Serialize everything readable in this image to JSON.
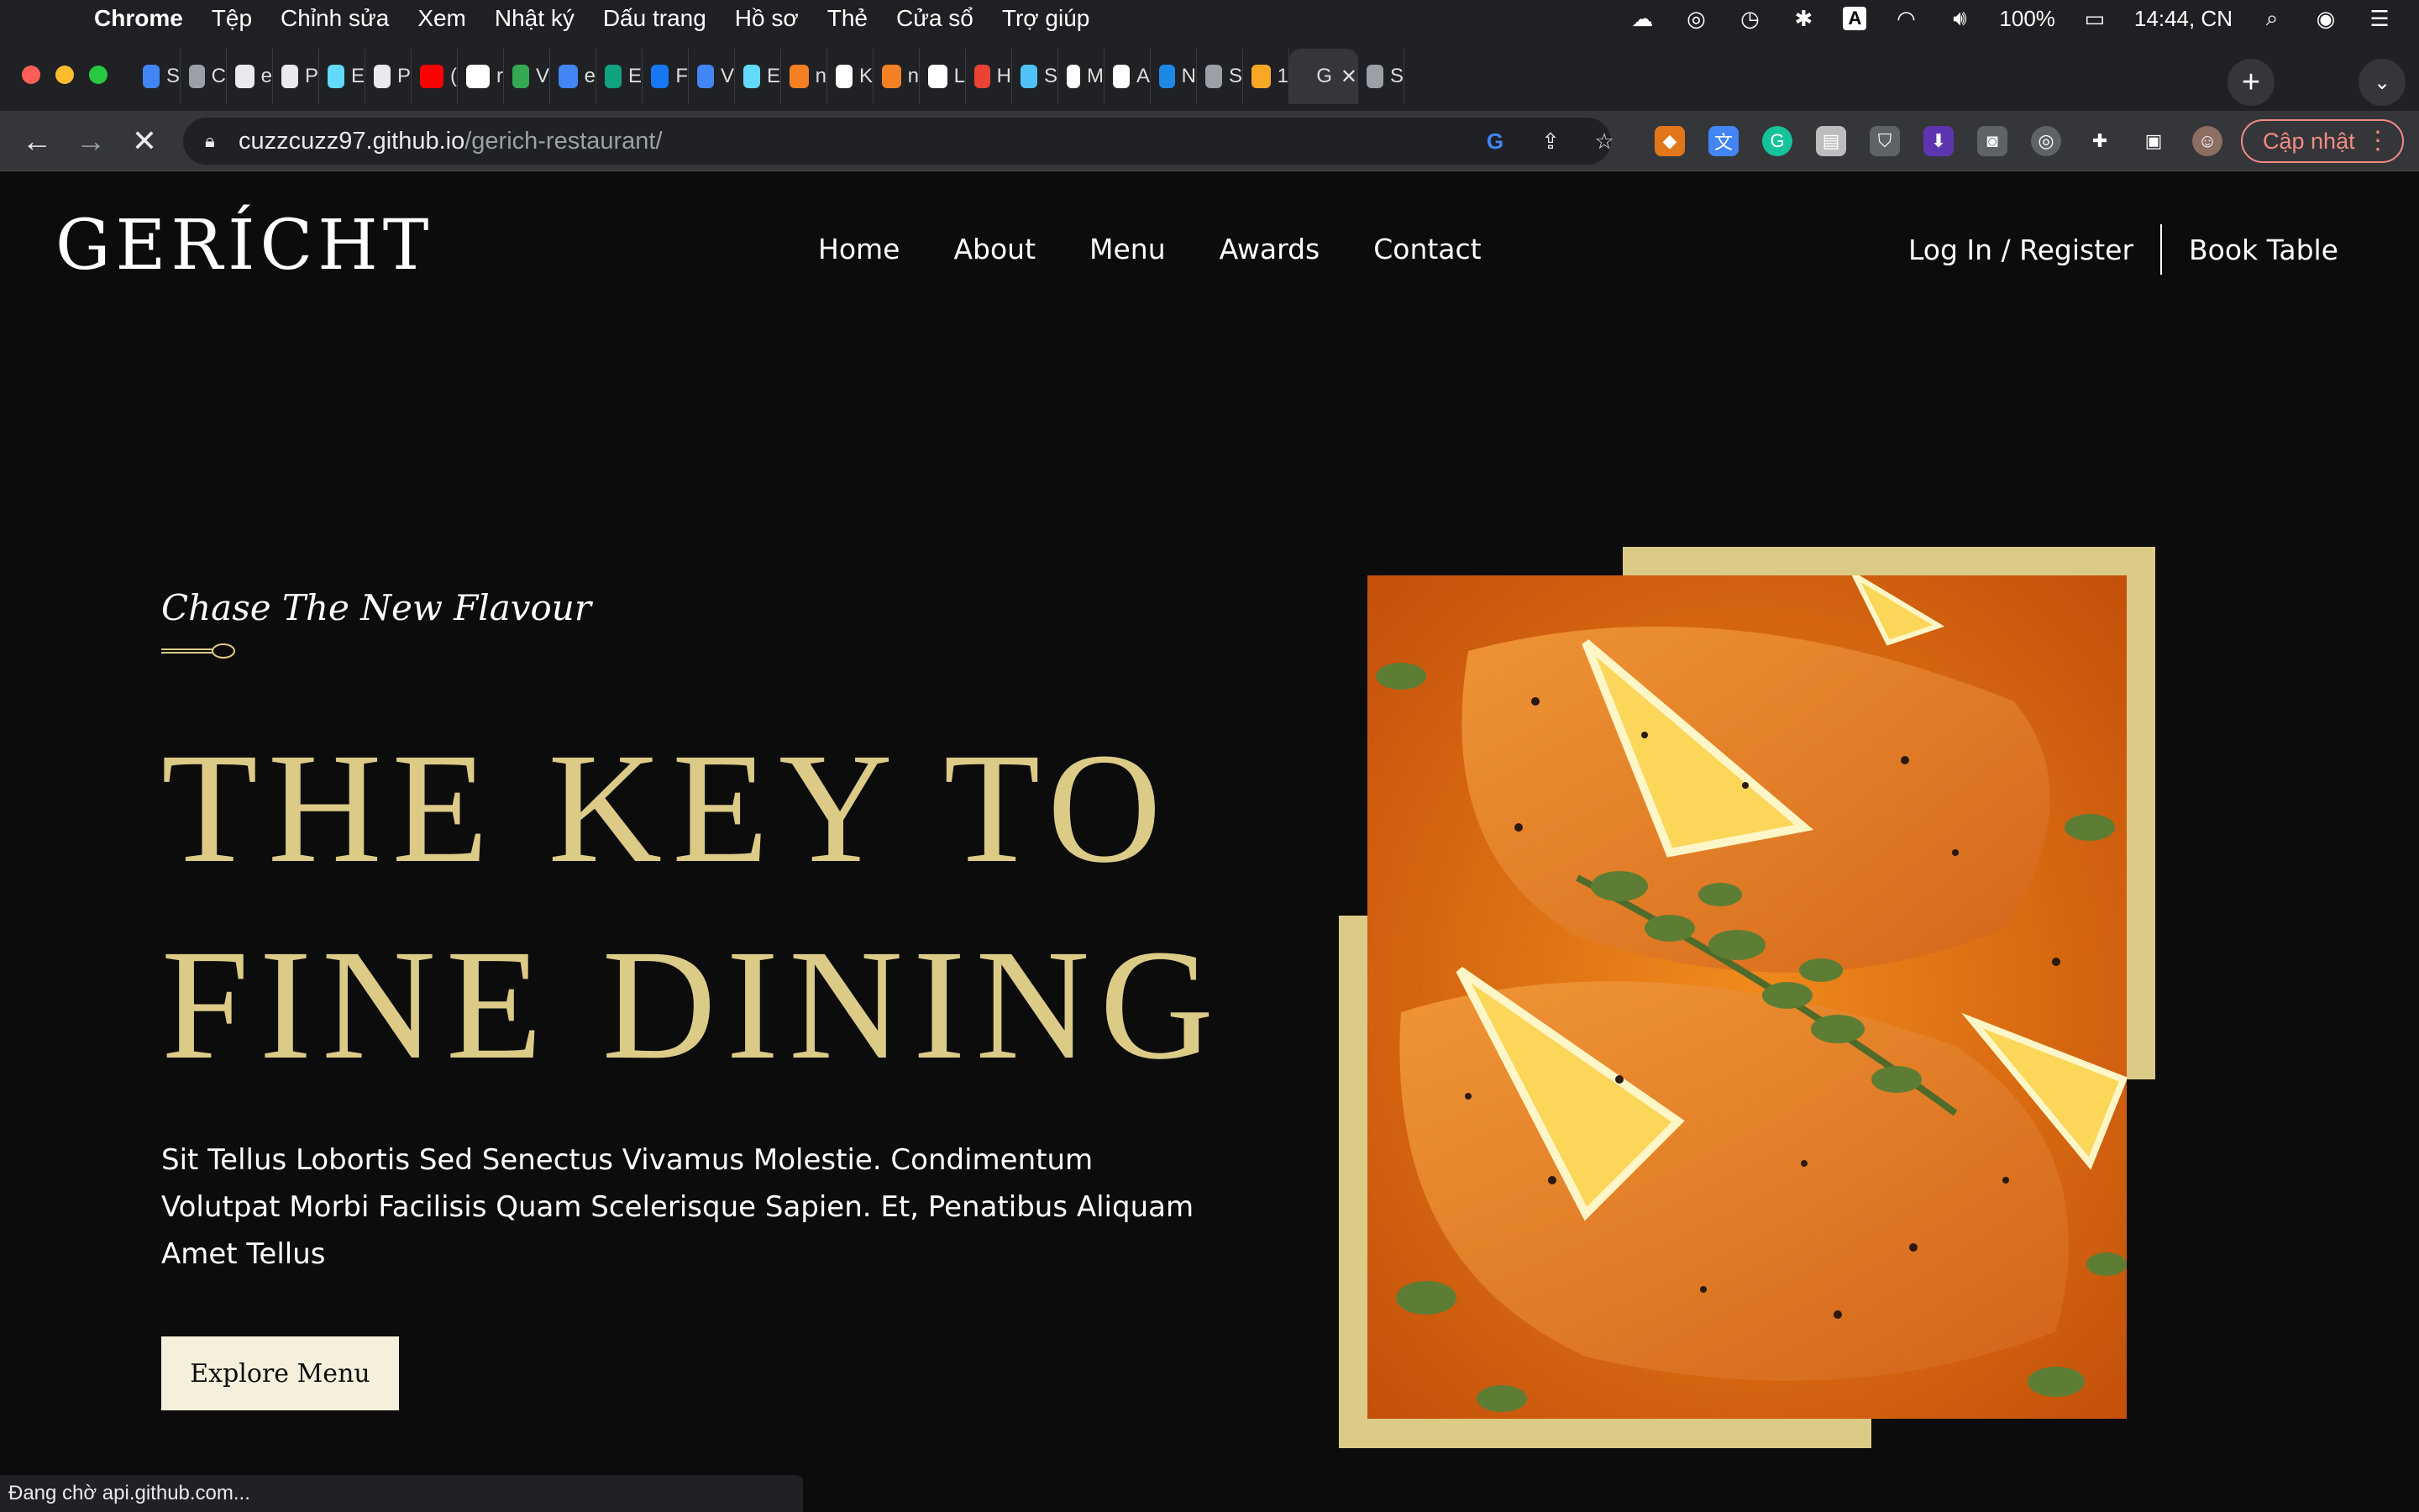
{
  "menubar": {
    "app": "Chrome",
    "items": [
      "Tệp",
      "Chỉnh sửa",
      "Xem",
      "Nhật ký",
      "Dấu trang",
      "Hồ sơ",
      "Thẻ",
      "Cửa sổ",
      "Trợ giúp"
    ],
    "battery": "100%",
    "clock": "14:44, CN"
  },
  "tabs": [
    {
      "letter": "S",
      "color": "#4285f4",
      "icon": "docs-icon"
    },
    {
      "letter": "C",
      "color": "#9aa0a6",
      "icon": "globe-icon"
    },
    {
      "letter": "e",
      "color": "#e8eaed",
      "icon": "sketch-icon"
    },
    {
      "letter": "P",
      "color": "#e8eaed",
      "icon": "sketch-icon"
    },
    {
      "letter": "E",
      "color": "#61dafb",
      "icon": "react-icon"
    },
    {
      "letter": "P",
      "color": "#e8eaed",
      "icon": "sketch-icon"
    },
    {
      "letter": "(",
      "color": "#ff0000",
      "icon": "youtube-icon"
    },
    {
      "letter": "r",
      "color": "#ffffff",
      "icon": "github-icon"
    },
    {
      "letter": "V",
      "color": "#34a853",
      "icon": "drive-icon"
    },
    {
      "letter": "e",
      "color": "#4285f4",
      "icon": "docs-icon"
    },
    {
      "letter": "E",
      "color": "#10a37f",
      "icon": "chatgpt-icon"
    },
    {
      "letter": "F",
      "color": "#1877f2",
      "icon": "facebook-icon"
    },
    {
      "letter": "V",
      "color": "#4285f4",
      "icon": "docs-icon"
    },
    {
      "letter": "E",
      "color": "#61dafb",
      "icon": "react-icon"
    },
    {
      "letter": "n",
      "color": "#f48024",
      "icon": "stackoverflow-icon"
    },
    {
      "letter": "K",
      "color": "#ffffff",
      "icon": "google-icon"
    },
    {
      "letter": "n",
      "color": "#f48024",
      "icon": "stackoverflow-icon"
    },
    {
      "letter": "L",
      "color": "#ffffff",
      "icon": "google-icon"
    },
    {
      "letter": "H",
      "color": "#ea4335",
      "icon": "gmail-icon"
    },
    {
      "letter": "S",
      "color": "#4fc3f7",
      "icon": "chart-icon"
    },
    {
      "letter": "M",
      "color": "#ffffff",
      "icon": "google-icon"
    },
    {
      "letter": "A",
      "color": "#ffffff",
      "icon": "google-icon"
    },
    {
      "letter": "N",
      "color": "#1e88e5",
      "icon": "e-icon"
    },
    {
      "letter": "S",
      "color": "#9aa0a6",
      "icon": "globe-icon"
    },
    {
      "letter": "1",
      "color": "#f9a825",
      "icon": "d-icon"
    },
    {
      "letter": "G",
      "color": "#35363a",
      "icon": "close-icon",
      "active": true
    },
    {
      "letter": "S",
      "color": "#9aa0a6",
      "icon": "globe-icon"
    }
  ],
  "toolbar": {
    "url_host": "cuzzcuzz97.github.io",
    "url_path": "/gerich-restaurant/",
    "update_label": "Cập nhật"
  },
  "site": {
    "logo": "GERÍCHT",
    "nav": [
      "Home",
      "About",
      "Menu",
      "Awards",
      "Contact"
    ],
    "login": "Log In / Register",
    "book": "Book Table",
    "subtitle": "Chase The New Flavour",
    "headline_1": "THE KEY TO",
    "headline_2": "FINE DINING",
    "description": "Sit Tellus Lobortis Sed Senectus Vivamus Molestie. Condimentum Volutpat Morbi Facilisis Quam Scelerisque Sapien. Et, Penatibus Aliquam Amet Tellus",
    "cta": "Explore Menu"
  },
  "colors": {
    "background": "#0c0c0c",
    "gold": "#dcca87",
    "crimson": "#f5efdb"
  },
  "status": "Đang chờ api.github.com..."
}
